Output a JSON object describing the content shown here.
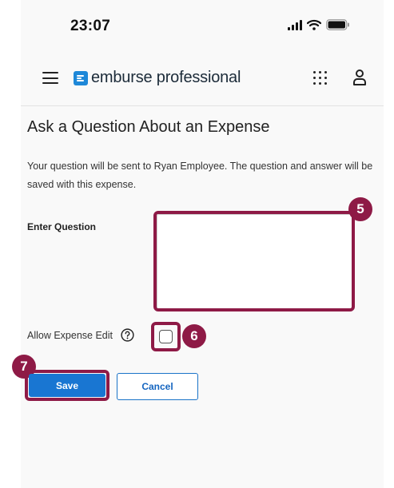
{
  "status_bar": {
    "time": "23:07"
  },
  "header": {
    "app_name_main": "emburse",
    "app_name_sub": " professional"
  },
  "page": {
    "title": "Ask a Question About an Expense",
    "intro": "Your question will be sent to Ryan Employee. The question and answer will be saved with this expense."
  },
  "form": {
    "question_label": "Enter Question",
    "question_value": "",
    "allow_edit_label": "Allow Expense Edit",
    "allow_edit_checked": false
  },
  "buttons": {
    "save_label": "Save",
    "cancel_label": "Cancel"
  },
  "annotations": {
    "question_step": "5",
    "checkbox_step": "6",
    "save_step": "7"
  },
  "colors": {
    "highlight": "#8e1a46",
    "primary": "#1976d2",
    "brand": "#1e88d8"
  },
  "icons": [
    "menu-icon",
    "emburse-logo-icon",
    "apps-grid-icon",
    "user-icon",
    "help-icon",
    "signal-icon",
    "wifi-icon",
    "battery-icon"
  ]
}
